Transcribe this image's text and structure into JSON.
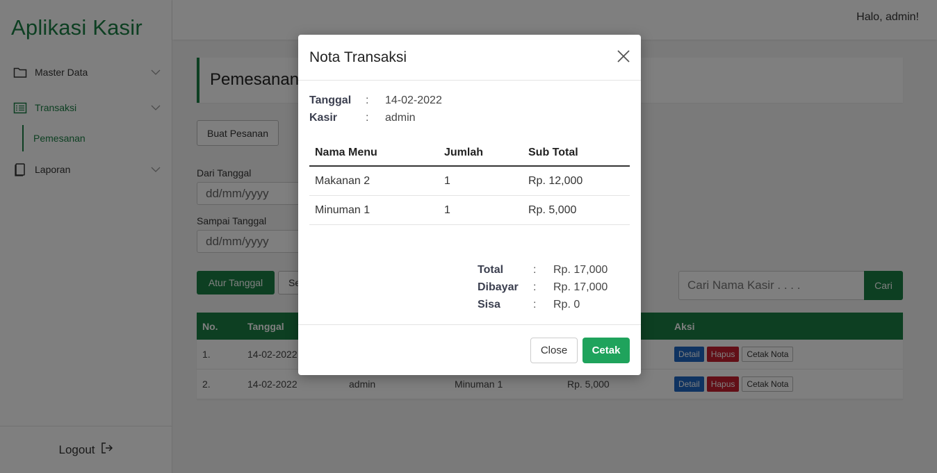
{
  "app": {
    "brand": "Aplikasi Kasir",
    "greeting": "Halo, admin!",
    "accent": "#1b7f44"
  },
  "sidebar": {
    "items": [
      {
        "label": "Master Data",
        "icon": "folder-icon"
      },
      {
        "label": "Transaksi",
        "icon": "list-icon"
      },
      {
        "label": "Laporan",
        "icon": "document-icon"
      }
    ],
    "subitem": "Pemesanan",
    "logout": "Logout"
  },
  "main": {
    "page_title": "Pemesanan",
    "new_order_button": "Buat Pesanan",
    "from_label": "Dari Tanggal",
    "from_placeholder": "dd/mm/yyyy",
    "to_label": "Sampai Tanggal",
    "to_placeholder": "dd/mm/yyyy",
    "set_date_button": "Atur Tanggal",
    "second_button_partial": "Se",
    "search_placeholder": "Cari Nama Kasir . . . .",
    "search_button": "Cari",
    "table": {
      "headers": [
        "No.",
        "Tanggal",
        "Aksi"
      ],
      "rows": [
        {
          "no": "1.",
          "tanggal": "14-02-2022",
          "kasir": "",
          "menu": "",
          "total": ""
        },
        {
          "no": "2.",
          "tanggal": "14-02-2022",
          "kasir": "admin",
          "menu": "Minuman 1",
          "total": "Rp. 5,000"
        }
      ],
      "actions": {
        "detail": "Detail",
        "delete": "Hapus",
        "print": "Cetak Nota"
      }
    }
  },
  "modal": {
    "title": "Nota Transaksi",
    "info": [
      {
        "key": "Tanggal",
        "value": "14-02-2022"
      },
      {
        "key": "Kasir",
        "value": "admin"
      }
    ],
    "table": {
      "headers": [
        "Nama Menu",
        "Jumlah",
        "Sub Total"
      ],
      "rows": [
        {
          "menu": "Makanan 2",
          "qty": "1",
          "subtotal": "Rp. 12,000"
        },
        {
          "menu": "Minuman 1",
          "qty": "1",
          "subtotal": "Rp. 5,000"
        }
      ]
    },
    "summary": [
      {
        "key": "Total",
        "value": "Rp. 17,000"
      },
      {
        "key": "Dibayar",
        "value": "Rp. 17,000"
      },
      {
        "key": "Sisa",
        "value": "Rp. 0"
      }
    ],
    "colon": ":",
    "close_button": "Close",
    "print_button": "Cetak"
  }
}
